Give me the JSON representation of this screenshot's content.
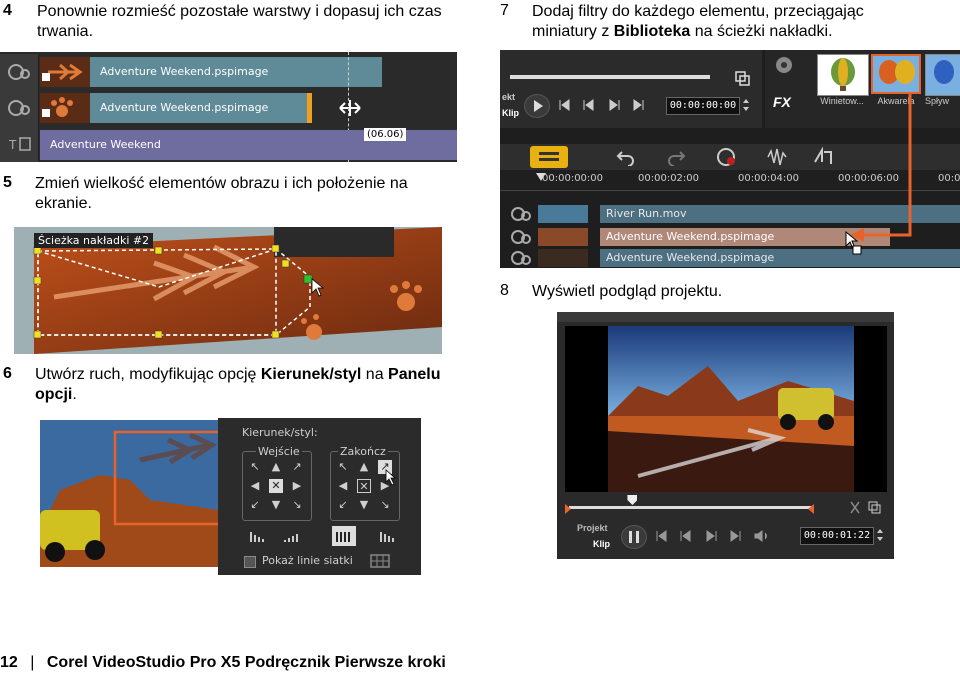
{
  "steps": {
    "s4": {
      "num": "4",
      "text": "Ponownie rozmieść pozostałe warstwy i dopasuj ich czas trwania."
    },
    "s7": {
      "num": "7",
      "text_a": "Dodaj filtry do każdego elementu, przeciągając miniatury z ",
      "bold": "Biblioteka",
      "text_b": " na ścieżki nakładki."
    },
    "s5": {
      "num": "5",
      "text": "Zmień wielkość elementów obrazu i ich położenie na ekranie."
    },
    "s8": {
      "num": "8",
      "text": "Wyświetl podgląd projektu."
    },
    "s6": {
      "num": "6",
      "text_a": "Utwórz ruch, modyfikując opcję ",
      "bold1": "Kierunek/styl",
      "text_b": " na ",
      "bold2": "Panelu opcji",
      "text_c": "."
    }
  },
  "panel4": {
    "clip1": "Adventure Weekend.pspimage",
    "clip2": "Adventure Weekend.pspimage",
    "title_clip": "Adventure Weekend",
    "duration_tip": "(06.06)"
  },
  "panel7": {
    "mode_project": "ekt",
    "mode_clip": "Klip",
    "timecode": "00:00:00:00",
    "fx_label": "FX",
    "thumbs": [
      "Winietow...",
      "Akwarela",
      "Spływ"
    ],
    "ruler": [
      "00:00:00:00",
      "00:00:02:00",
      "00:00:04:00",
      "00:00:06:00",
      "00:0"
    ],
    "tracks": [
      "River Run.mov",
      "Adventure Weekend.pspimage",
      "Adventure Weekend.pspimage"
    ]
  },
  "panel5": {
    "overlay_label": "Ścieżka nakładki #2"
  },
  "panel6": {
    "title": "Kierunek/styl:",
    "entry": "Wejście",
    "exit": "Zakończ",
    "grid_label": "Pokaż linie siatki"
  },
  "panel8": {
    "mode_project": "Projekt",
    "mode_clip": "Klip",
    "timecode": "00:00:01:22",
    "progress": 0.26
  },
  "footer": {
    "page": "12",
    "sep": "|",
    "title": "Corel VideoStudio Pro X5 Podręcznik Pierwsze kroki"
  },
  "colors": {
    "accent_orange": "#e8632b",
    "clip_teal": "#5f8a98",
    "title_purple": "#6f6c9f"
  }
}
